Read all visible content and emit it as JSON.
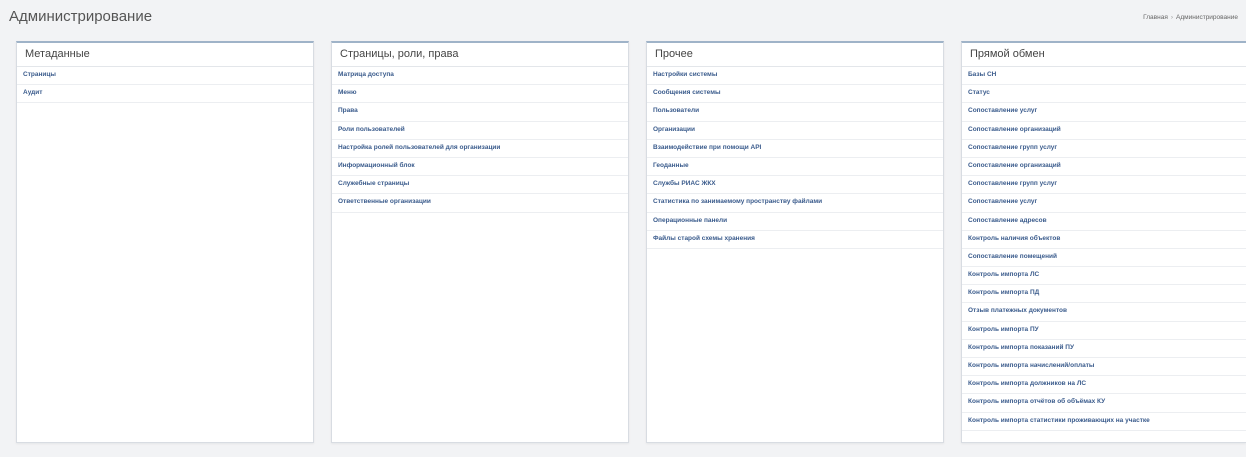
{
  "page": {
    "title": "Администрирование",
    "breadcrumb": [
      "Главная",
      "Администрирование"
    ]
  },
  "panels": [
    {
      "title": "Метаданные",
      "items": [
        "Страницы",
        "Аудит"
      ]
    },
    {
      "title": "Страницы, роли, права",
      "items": [
        "Матрица доступа",
        "Меню",
        "Права",
        "Роли пользователей",
        "Настройка ролей пользователей для организации",
        "Информационный блок",
        "Служебные страницы",
        "Ответственные организации"
      ]
    },
    {
      "title": "Прочее",
      "items": [
        "Настройки системы",
        "Сообщения системы",
        "Пользователи",
        "Организации",
        "Взаимодействие при помощи API",
        "Геоданные",
        "Службы РИАС ЖКХ",
        "Статистика по занимаемому пространству файлами",
        "Операционные панели",
        "Файлы старой схемы хранения"
      ]
    },
    {
      "title": "Прямой обмен",
      "items": [
        "Базы СН",
        "Статус",
        "Сопоставление услуг",
        "Сопоставление организаций",
        "Сопоставление групп услуг",
        "Сопоставление организаций",
        "Сопоставление групп услуг",
        "Сопоставление услуг",
        "Сопоставление адресов",
        "Контроль наличия объектов",
        "Сопоставление помещений",
        "Контроль импорта ЛС",
        "Контроль импорта ПД",
        "Отзыв платежных документов",
        "Контроль импорта ПУ",
        "Контроль импорта показаний ПУ",
        "Контроль импорта начислений/оплаты",
        "Контроль импорта должников на ЛС",
        "Контроль импорта отчётов об объёмах КУ",
        "Контроль импорта статистики проживающих на участке"
      ]
    }
  ]
}
